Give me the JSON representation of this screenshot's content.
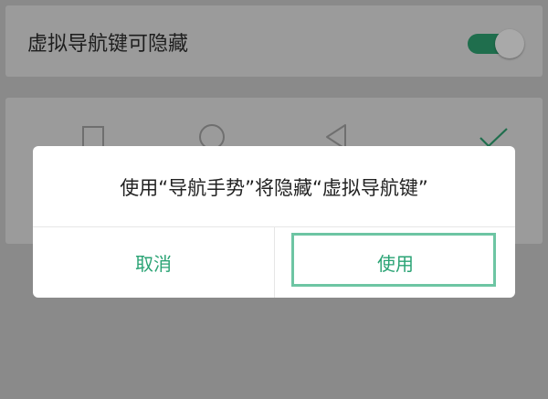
{
  "setting": {
    "label": "虚拟导航键可隐藏",
    "toggle_on": true,
    "toggle_color": "#1f6e4d"
  },
  "nav_options": {
    "icons": [
      "square-icon",
      "circle-icon",
      "triangle-back-icon",
      "checkmark-icon"
    ],
    "icon_color": "#6f6f6f",
    "check_color": "#1f6e4d"
  },
  "dialog": {
    "message": "使用“导航手势”将隐藏“虚拟导航键”",
    "cancel_label": "取消",
    "confirm_label": "使用",
    "accent": "#2aa374",
    "focus_border": "#6dc5a3"
  }
}
